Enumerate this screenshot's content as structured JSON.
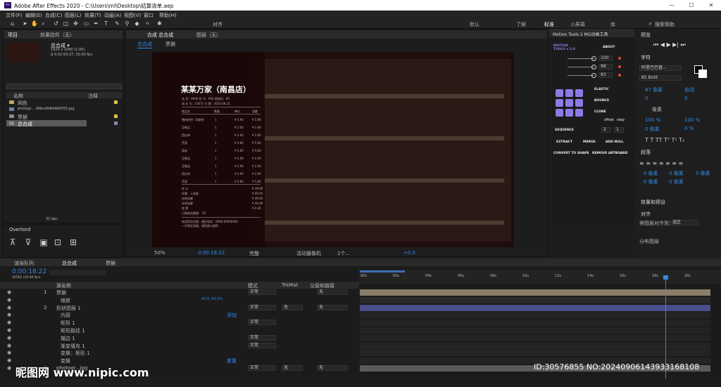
{
  "window": {
    "logo": "Ae",
    "title": "Adobe After Effects 2020 - C:\\Users\\ml\\Desktop\\结算清单.aep",
    "min": "—",
    "max": "☐",
    "close": "✕"
  },
  "menu": [
    "文件(F)",
    "编辑(E)",
    "合成(C)",
    "图层(L)",
    "效果(T)",
    "动画(A)",
    "视图(V)",
    "窗口",
    "帮助(H)"
  ],
  "toolbar": {
    "snap": "对齐",
    "workspaces": [
      "默认",
      "了解",
      "标准",
      "小屏幕",
      "库"
    ],
    "search_placeholder": "搜索帮助"
  },
  "project": {
    "tab": "项目",
    "effects_tab": "效果控件（无）",
    "comp_name": "总合成 ▾",
    "comp_res": "1920 x 1080 (1.00)",
    "comp_dur": "Δ 0:02:50:27, 30.00 fps",
    "col_name": "名称",
    "col_comment": "注释",
    "items": [
      "网色",
      "photogr... d6bce8dfd4b0555.jpg",
      "票据",
      "总合成"
    ],
    "bpc": "32 bpc"
  },
  "overlord": {
    "title": "Overlord"
  },
  "comp": {
    "tab": "合成 总合成",
    "layer_tab": "图层（无）",
    "crumb1": "总合成",
    "crumb2": "票据",
    "zoom": "50%",
    "timecode": "0:00:18:22",
    "quality": "完整",
    "camera": "活动摄像机",
    "views": "1个...",
    "exposure": "+0.0"
  },
  "receipt": {
    "title": "某某万家（南昌店）",
    "meta1": "店 员：4000   机 号：P00   收银员：00",
    "meta2": "流 水 号：23071   日 期：2024.08.21",
    "head": [
      "商品名",
      "数量",
      "单价",
      "金额"
    ],
    "rows": [
      [
        "猪肉饼饼（3枚装）",
        "1",
        "¥ 5.90",
        "¥ 5.90"
      ],
      [
        "豆制品",
        "1",
        "¥ 2.00",
        "¥ 2.00"
      ],
      [
        "西红柿",
        "1",
        "¥ 2.00",
        "¥ 2.00"
      ],
      [
        "芹菜",
        "1",
        "¥ 5.60",
        "¥ 5.60"
      ],
      [
        "蒜苗",
        "1",
        "¥ 5.60",
        "¥ 5.60"
      ],
      [
        "豆制品",
        "1",
        "¥ 2.00",
        "¥ 2.00"
      ],
      [
        "豆制品",
        "1",
        "¥ 2.00",
        "¥ 2.00"
      ],
      [
        "西红柿",
        "1",
        "¥ 2.00",
        "¥ 2.00"
      ],
      [
        "芹菜",
        "1",
        "¥ 5.60",
        "¥ 5.60"
      ]
    ],
    "totals": [
      [
        "合 计",
        "¥ 39.60"
      ],
      [
        "优惠：入场卷",
        "¥ 40.00"
      ],
      [
        "应收金额",
        "¥ 39.60"
      ],
      [
        "实收金额",
        "¥ 40.00"
      ],
      [
        "找   零",
        "¥ 0.40"
      ],
      [
        "已购商品数量：  63",
        ""
      ]
    ],
    "foot1": "欢迎再次光临：请在电话：0000-00000000",
    "foot2": "一字保证质量，请您放心使用"
  },
  "motion": {
    "title": "Motion Tools 2 MG动画工具",
    "logo": "MOTION TOOLS v 2.0",
    "about": "ABOUT",
    "sliders": [
      "100",
      "98",
      "83"
    ],
    "elastic": "ELASTIC",
    "bounce": "BOUNCE",
    "clone": "CLONE",
    "offset": "offset",
    "step": "step",
    "offset_val": "2",
    "step_val": "1",
    "sequence": "SEQUENCE",
    "extract": "EXTRACT",
    "merge": "MERGE",
    "add_null": "ADD NULL",
    "convert": "CONVERT TO SHAPE",
    "remove": "REMOVE ARTBOARD"
  },
  "preview": {
    "title": "预览"
  },
  "char": {
    "title": "字符",
    "font": "阿里巴巴普...",
    "style": "85 Bold",
    "size": "87 像素",
    "leading": "自动",
    "kern": "0",
    "track": "0",
    "unit": "像素",
    "vscale": "100 %",
    "hscale": "100 %",
    "baseline": "0 像素",
    "tsume": "0 %"
  },
  "para": {
    "title": "段落",
    "indent": [
      "0 像素",
      "0 像素",
      "0 像素",
      "0 像素",
      "0 像素"
    ]
  },
  "effects_presets": "效果和预设",
  "align": {
    "title": "对齐",
    "align_to": "将图层对齐到：",
    "target": "选区",
    "distribute": "分布图层"
  },
  "timeline": {
    "render_tab": "渲染队列",
    "comp_tab": "总合成",
    "receipt_tab": "票据",
    "timecode": "0:00:18:22",
    "frames": "00562 (30.00 fps)",
    "col_name": "源名称",
    "col_mode": "模式",
    "col_trk": "TrkMat",
    "col_parent": "父级和链接",
    "ticks": [
      "00s",
      "02s",
      "04s",
      "06s",
      "08s",
      "10s",
      "12s",
      "14s",
      "16s",
      "18s",
      "20s"
    ],
    "layers": [
      {
        "num": "1",
        "name": "票据",
        "mode": "正常",
        "parent": "无"
      },
      {
        "num": "",
        "name": "缩放",
        "value": "43.0, 43.0%"
      },
      {
        "num": "2",
        "name": "形状图层 1",
        "mode": "正常",
        "trk": "无",
        "parent": "无"
      },
      {
        "num": "",
        "name": "内容",
        "extra": "添加"
      },
      {
        "num": "",
        "name": "矩形 1",
        "mode": "正常"
      },
      {
        "num": "",
        "name": "矩形路径 1"
      },
      {
        "num": "",
        "name": "描边 1",
        "mode": "正常"
      },
      {
        "num": "",
        "name": "渐变填充 1",
        "mode": "正常"
      },
      {
        "num": "",
        "name": "变换：矩形 1"
      },
      {
        "num": "",
        "name": "变换",
        "extra": "重置"
      },
      {
        "num": "3",
        "name": "photogr...jpg",
        "mode": "正常",
        "trk": "无",
        "parent": "无"
      }
    ]
  },
  "watermark": {
    "site": "昵图网 www.nipic.com",
    "id": "ID:30576855 NO:20240906143933168108"
  }
}
